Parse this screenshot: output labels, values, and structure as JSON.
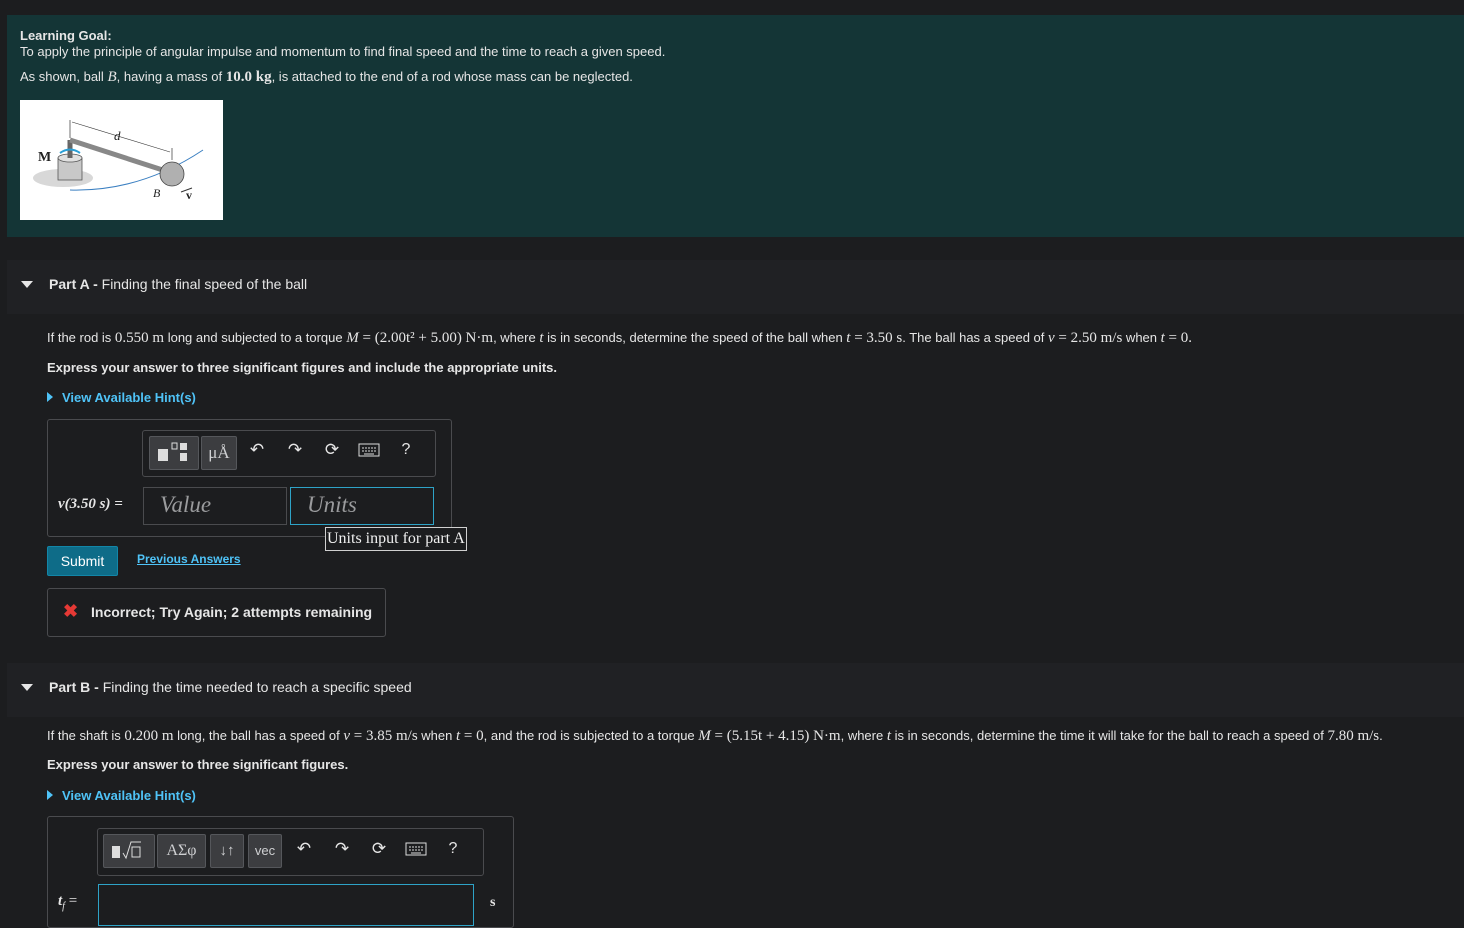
{
  "intro": {
    "title": "Learning Goal:",
    "goal": "To apply the principle of angular impulse and momentum to find final speed and the time to reach a given speed.",
    "desc_pre": "As shown, ball ",
    "desc_var": "B",
    "desc_mid": ", having a mass of ",
    "desc_mass": "10.0 kg",
    "desc_post": ", is attached to the end of a rod whose mass can be neglected.",
    "figure": {
      "label_M": "M",
      "label_d": "d",
      "label_B": "B",
      "label_v": "v"
    }
  },
  "partA": {
    "title_bold": "Part A - ",
    "title": "Finding the final speed of the ball",
    "q_1": "If the rod is ",
    "q_len": "0.550 m",
    "q_2": " long and subjected to a torque ",
    "q_M": "M",
    "q_eq": " = (2.00t² + 5.00) N·m",
    "q_3": ", where ",
    "q_t": "t",
    "q_4": " is in seconds, determine the speed of the ball when ",
    "q_t2": "t",
    "q_eq2": " = 3.50 s",
    "q_5": ". The ball has a speed of ",
    "q_v": "v",
    "q_eq3": " = 2.50 m/s",
    "q_6": " when ",
    "q_t3": "t",
    "q_eq4": " = 0.",
    "instruction": "Express your answer to three significant figures and include the appropriate units.",
    "hint": "View Available Hint(s)",
    "toolbar": {
      "units_btn": "μÅ",
      "help": "?"
    },
    "answer_label": "v(3.50 s) =",
    "value_placeholder": "Value",
    "units_placeholder": "Units",
    "tooltip": "Units input for part A",
    "submit": "Submit",
    "previous": "Previous Answers",
    "feedback_icon": "✖",
    "feedback": "Incorrect; Try Again; 2 attempts remaining"
  },
  "partB": {
    "title_bold": "Part B - ",
    "title": "Finding the time needed to reach a specific speed",
    "q_1": "If the shaft is ",
    "q_len": "0.200 m",
    "q_2": " long, the ball has a speed of ",
    "q_v": "v",
    "q_eq1": " = 3.85 m/s",
    "q_3": " when ",
    "q_t": "t",
    "q_eq2": " = 0",
    "q_4": ", and the rod is subjected to a torque ",
    "q_M": "M",
    "q_eq3": " = (5.15t + 4.15) N·m",
    "q_5": ", where ",
    "q_t2": "t",
    "q_6": " is in seconds, determine the time it will take for the ball to reach a speed of ",
    "q_eq4": "7.80 m/s",
    "q_7": ".",
    "instruction": "Express your answer to three significant figures.",
    "hint": "View Available Hint(s)",
    "toolbar": {
      "greek": "ΑΣφ",
      "arrows": "↓↑",
      "vec": "vec",
      "help": "?"
    },
    "answer_label": "t",
    "answer_sub": "f",
    "answer_eq": " =",
    "unit": "s"
  },
  "colors": {
    "intro_bg": "#143536",
    "accent": "#4fc3f7",
    "submit": "#0e6c88",
    "error": "#e53935"
  }
}
